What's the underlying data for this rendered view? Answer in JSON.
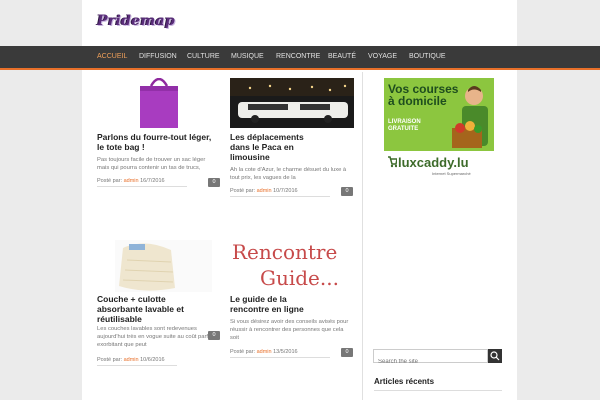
{
  "site": {
    "logo": "Pridemap"
  },
  "nav": {
    "items": [
      {
        "label": "ACCUEIL",
        "active": true
      },
      {
        "label": "DIFFUSION"
      },
      {
        "label": "CULTURE"
      },
      {
        "label": "MUSIQUE"
      },
      {
        "label": "RENCONTRE"
      },
      {
        "label": "BEAUTÉ"
      },
      {
        "label": "VOYAGE"
      },
      {
        "label": "BOUTIQUE"
      }
    ]
  },
  "posts": [
    {
      "title": "Parlons du fourre-tout léger, le tote bag !",
      "excerpt": "Pas toujours facile de trouver un sac léger mais qui pourra contenir un tas de trucs,",
      "meta_prefix": "Posté par:",
      "author": "admin",
      "date": "16/7/2016",
      "comments": "0"
    },
    {
      "title": "Les déplacements dans le Paca en limousine",
      "excerpt": "Ah la cote d'Azur, le charme désuet du luxe à tout prix, les vagues de la",
      "meta_prefix": "Posté par:",
      "author": "admin",
      "date": "10/7/2016",
      "comments": "0"
    },
    {
      "title": "Couche + culotte absorbante lavable et réutilisable",
      "excerpt": "Les couches lavables sont redevenues aujourd'hui très en vogue suite au coût parfois exorbitant que peut",
      "meta_prefix": "Posté par:",
      "author": "admin",
      "date": "10/6/2016",
      "comments": "0"
    },
    {
      "title": "Le guide de la rencontre en ligne",
      "excerpt": "Si vous désirez avoir des conseils avisés pour réussir à rencontrer des personnes que cela soit",
      "meta_prefix": "Posté par:",
      "author": "admin",
      "date": "13/5/2016",
      "comments": "0",
      "thumb_text_1": "Rencontre",
      "thumb_text_2": "Guide..."
    }
  ],
  "ad": {
    "headline": "Vos courses à domicile",
    "sub": "LIVRAISON GRATUITE",
    "brand": "luxcaddy.lu",
    "tagline": "Internet Supermarché"
  },
  "search": {
    "placeholder": "Search the site"
  },
  "widgets": {
    "recent_title": "Articles récents"
  },
  "colors": {
    "accent": "#e8702a",
    "nav_bg": "#3a3a3a",
    "page_bg": "#ebebeb"
  }
}
